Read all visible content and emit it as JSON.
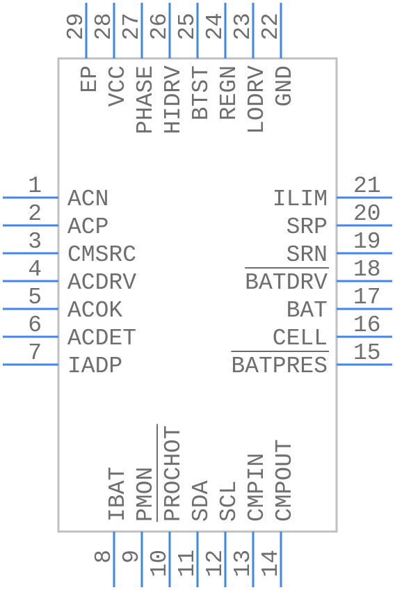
{
  "colors": {
    "pin": "#3f86f0",
    "body": "#c0c0c0",
    "text": "#6e6e6e"
  },
  "pins": {
    "left": [
      {
        "num": "1",
        "name": "ACN"
      },
      {
        "num": "2",
        "name": "ACP"
      },
      {
        "num": "3",
        "name": "CMSRC"
      },
      {
        "num": "4",
        "name": "ACDRV"
      },
      {
        "num": "5",
        "name": "ACOK"
      },
      {
        "num": "6",
        "name": "ACDET"
      },
      {
        "num": "7",
        "name": "IADP"
      }
    ],
    "right": [
      {
        "num": "21",
        "name": "ILIM"
      },
      {
        "num": "20",
        "name": "SRP"
      },
      {
        "num": "19",
        "name": "SRN"
      },
      {
        "num": "18",
        "name": "BATDRV",
        "active_low": true
      },
      {
        "num": "17",
        "name": "BAT"
      },
      {
        "num": "16",
        "name": "CELL"
      },
      {
        "num": "15",
        "name": "BATPRES",
        "active_low": true
      }
    ],
    "top": [
      {
        "num": "29",
        "name": "EP"
      },
      {
        "num": "28",
        "name": "VCC"
      },
      {
        "num": "27",
        "name": "PHASE"
      },
      {
        "num": "26",
        "name": "HIDRV"
      },
      {
        "num": "25",
        "name": "BTST"
      },
      {
        "num": "24",
        "name": "REGN"
      },
      {
        "num": "23",
        "name": "LODRV"
      },
      {
        "num": "22",
        "name": "GND"
      }
    ],
    "bottom": [
      {
        "num": "8",
        "name": "IBAT"
      },
      {
        "num": "9",
        "name": "PMON"
      },
      {
        "num": "10",
        "name": "PROCHOT",
        "active_low": true
      },
      {
        "num": "11",
        "name": "SDA"
      },
      {
        "num": "12",
        "name": "SCL"
      },
      {
        "num": "13",
        "name": "CMPIN"
      },
      {
        "num": "14",
        "name": "CMPOUT"
      }
    ]
  }
}
